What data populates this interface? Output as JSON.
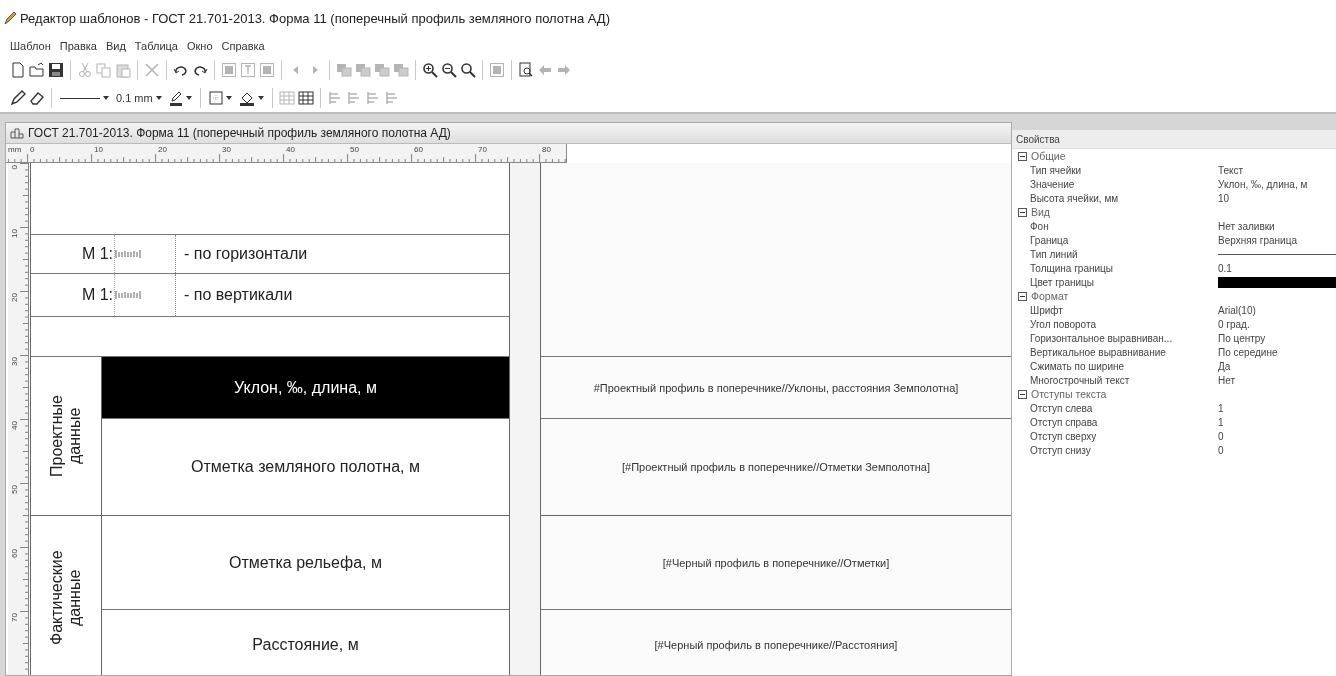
{
  "window": {
    "title": "Редактор шаблонов - ГОСТ 21.701-2013. Форма 11 (поперечный профиль земляного полотна АД)"
  },
  "menu": [
    {
      "label": "Шаблон"
    },
    {
      "label": "Правка"
    },
    {
      "label": "Вид"
    },
    {
      "label": "Таблица"
    },
    {
      "label": "Окно"
    },
    {
      "label": "Справка"
    }
  ],
  "toolbars": [
    [
      {
        "kind": "new",
        "disabled": false
      },
      {
        "kind": "open",
        "disabled": false
      },
      {
        "kind": "save",
        "disabled": false
      },
      {
        "kind": "sep"
      },
      {
        "kind": "cut",
        "disabled": true
      },
      {
        "kind": "copy",
        "disabled": true
      },
      {
        "kind": "paste",
        "disabled": true
      },
      {
        "kind": "sep"
      },
      {
        "kind": "delete",
        "disabled": true
      },
      {
        "kind": "sep"
      },
      {
        "kind": "undo",
        "disabled": false
      },
      {
        "kind": "redo",
        "disabled": false
      },
      {
        "kind": "sep"
      },
      {
        "kind": "image-frame",
        "disabled": true
      },
      {
        "kind": "text-frame",
        "disabled": true
      },
      {
        "kind": "picture-frame",
        "disabled": true
      },
      {
        "kind": "sep"
      },
      {
        "kind": "prev",
        "disabled": true
      },
      {
        "kind": "next",
        "disabled": true
      },
      {
        "kind": "sep"
      },
      {
        "kind": "layer",
        "disabled": true
      },
      {
        "kind": "layer",
        "disabled": true
      },
      {
        "kind": "layer",
        "disabled": true
      },
      {
        "kind": "layer",
        "disabled": true
      },
      {
        "kind": "sep"
      },
      {
        "kind": "zoom-in",
        "disabled": false
      },
      {
        "kind": "zoom-out",
        "disabled": false
      },
      {
        "kind": "zoom-fit",
        "disabled": false
      },
      {
        "kind": "sep"
      },
      {
        "kind": "fit-page",
        "disabled": true
      },
      {
        "kind": "sep"
      },
      {
        "kind": "preview",
        "disabled": false
      },
      {
        "kind": "back",
        "disabled": true
      },
      {
        "kind": "forward",
        "disabled": true
      }
    ],
    [
      {
        "kind": "pencil",
        "disabled": false
      },
      {
        "kind": "eraser",
        "disabled": false
      },
      {
        "kind": "sep"
      },
      {
        "kind": "line-style",
        "disabled": false
      },
      {
        "kind": "width",
        "label": "0.1 mm",
        "disabled": false
      },
      {
        "kind": "pen-color",
        "disabled": false
      },
      {
        "kind": "sep"
      },
      {
        "kind": "border",
        "disabled": false
      },
      {
        "kind": "fill",
        "disabled": false
      },
      {
        "kind": "sep"
      },
      {
        "kind": "merge",
        "disabled": true
      },
      {
        "kind": "grid",
        "disabled": false
      },
      {
        "kind": "sep"
      },
      {
        "kind": "align",
        "disabled": true
      },
      {
        "kind": "align",
        "disabled": true
      },
      {
        "kind": "align",
        "disabled": true
      },
      {
        "kind": "align",
        "disabled": true
      }
    ]
  ],
  "document": {
    "title": "ГОСТ 21.701-2013. Форма 11 (поперечный профиль земляного полотна АД)",
    "ruler": {
      "unit": "mm",
      "x_labels": [
        "0",
        "10",
        "20",
        "30",
        "40",
        "50",
        "60",
        "70",
        "80"
      ],
      "y_labels": [
        "0",
        "10",
        "20",
        "30",
        "40",
        "50",
        "60",
        "70"
      ]
    },
    "header_rows": [
      {
        "kind": "blank"
      },
      {
        "kind": "scale",
        "prefix": "М 1:",
        "label": "- по горизонтали"
      },
      {
        "kind": "scale",
        "prefix": "М 1:",
        "label": "- по вертикали"
      },
      {
        "kind": "blank"
      }
    ],
    "groups": [
      {
        "label": "Проектные данные",
        "rows": [
          {
            "label": "Уклон, ‰, длина, м",
            "selected": true,
            "source": "#Проектный профиль в поперечнике//Уклоны, расстояния Земполотна]"
          },
          {
            "label": "Отметка земляного полотна, м",
            "selected": false,
            "source": "[#Проектный профиль в поперечнике//Отметки Земполотна]"
          }
        ]
      },
      {
        "label": "Фактические данные",
        "rows": [
          {
            "label": "Отметка рельефа, м",
            "selected": false,
            "source": "[#Черный профиль в поперечнике//Отметки]"
          },
          {
            "label": "Расстояние, м",
            "selected": false,
            "source": "[#Черный профиль в поперечнике//Расстояния]"
          }
        ]
      }
    ]
  },
  "properties": {
    "title": "Свойства",
    "groups": [
      {
        "label": "Общие",
        "expanded": true,
        "items": [
          {
            "kind": "text",
            "name": "Тип ячейки",
            "value": "Текст"
          },
          {
            "kind": "text",
            "name": "Значение",
            "value": "Уклон, ‰, длина, м"
          },
          {
            "kind": "text",
            "name": "Высота ячейки, мм",
            "value": "10"
          }
        ]
      },
      {
        "label": "Вид",
        "expanded": true,
        "items": [
          {
            "kind": "text",
            "name": "Фон",
            "value": "Нет заливки"
          },
          {
            "kind": "text",
            "name": "Граница",
            "value": "Верхняя граница"
          },
          {
            "kind": "line",
            "name": "Тип линий"
          },
          {
            "kind": "text",
            "name": "Толщина границы",
            "value": "0.1"
          },
          {
            "kind": "color",
            "name": "Цвет границы",
            "color": "#000000"
          }
        ]
      },
      {
        "label": "Формат",
        "expanded": true,
        "items": [
          {
            "kind": "text",
            "name": "Шрифт",
            "value": "Arial(10)"
          },
          {
            "kind": "text",
            "name": "Угол поворота",
            "value": "0 град."
          },
          {
            "kind": "text",
            "name": "Горизонтальное выравниван...",
            "value": "По центру"
          },
          {
            "kind": "text",
            "name": "Вертикальное выравнивание",
            "value": "По середине"
          },
          {
            "kind": "text",
            "name": "Сжимать по ширине",
            "value": "Да"
          },
          {
            "kind": "text",
            "name": "Многострочный текст",
            "value": "Нет"
          }
        ]
      },
      {
        "label": "Отступы текста",
        "expanded": true,
        "items": [
          {
            "kind": "text",
            "name": "Отступ слева",
            "value": "1"
          },
          {
            "kind": "text",
            "name": "Отступ справа",
            "value": "1"
          },
          {
            "kind": "text",
            "name": "Отступ сверху",
            "value": "0"
          },
          {
            "kind": "text",
            "name": "Отступ снизу",
            "value": "0"
          }
        ]
      }
    ]
  }
}
